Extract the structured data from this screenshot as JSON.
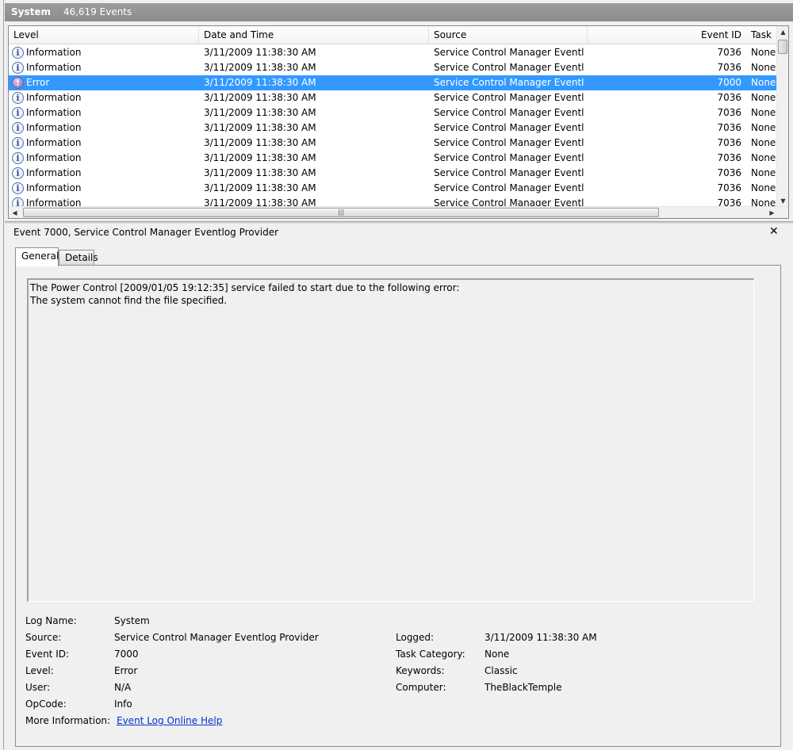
{
  "header": {
    "log_name": "System",
    "event_count": "46,619 Events"
  },
  "columns": {
    "level": "Level",
    "date": "Date and Time",
    "source": "Source",
    "event_id": "Event ID",
    "task": "Task"
  },
  "rows": [
    {
      "icon": "information-icon",
      "level": "Information",
      "date": "3/11/2009 11:38:30 AM",
      "source": "Service Control Manager Eventlog...",
      "event_id": "7036",
      "task": "None",
      "selected": false
    },
    {
      "icon": "information-icon",
      "level": "Information",
      "date": "3/11/2009 11:38:30 AM",
      "source": "Service Control Manager Eventlog...",
      "event_id": "7036",
      "task": "None",
      "selected": false
    },
    {
      "icon": "error-icon",
      "level": "Error",
      "date": "3/11/2009 11:38:30 AM",
      "source": "Service Control Manager Eventlog...",
      "event_id": "7000",
      "task": "None",
      "selected": true
    },
    {
      "icon": "information-icon",
      "level": "Information",
      "date": "3/11/2009 11:38:30 AM",
      "source": "Service Control Manager Eventlog...",
      "event_id": "7036",
      "task": "None",
      "selected": false
    },
    {
      "icon": "information-icon",
      "level": "Information",
      "date": "3/11/2009 11:38:30 AM",
      "source": "Service Control Manager Eventlog...",
      "event_id": "7036",
      "task": "None",
      "selected": false
    },
    {
      "icon": "information-icon",
      "level": "Information",
      "date": "3/11/2009 11:38:30 AM",
      "source": "Service Control Manager Eventlog...",
      "event_id": "7036",
      "task": "None",
      "selected": false
    },
    {
      "icon": "information-icon",
      "level": "Information",
      "date": "3/11/2009 11:38:30 AM",
      "source": "Service Control Manager Eventlog...",
      "event_id": "7036",
      "task": "None",
      "selected": false
    },
    {
      "icon": "information-icon",
      "level": "Information",
      "date": "3/11/2009 11:38:30 AM",
      "source": "Service Control Manager Eventlog...",
      "event_id": "7036",
      "task": "None",
      "selected": false
    },
    {
      "icon": "information-icon",
      "level": "Information",
      "date": "3/11/2009 11:38:30 AM",
      "source": "Service Control Manager Eventlog...",
      "event_id": "7036",
      "task": "None",
      "selected": false
    },
    {
      "icon": "information-icon",
      "level": "Information",
      "date": "3/11/2009 11:38:30 AM",
      "source": "Service Control Manager Eventlog...",
      "event_id": "7036",
      "task": "None",
      "selected": false
    },
    {
      "icon": "information-icon",
      "level": "Information",
      "date": "3/11/2009 11:38:30 AM",
      "source": "Service Control Manager Eventlog...",
      "event_id": "7036",
      "task": "None",
      "selected": false
    }
  ],
  "detail": {
    "title": "Event 7000, Service Control Manager Eventlog Provider",
    "close_icon": "close-icon",
    "tabs": {
      "general": "General",
      "details": "Details"
    },
    "message": [
      "The Power Control [2009/01/05 19:12:35] service failed to start due to the following error:",
      "The system cannot find the file specified."
    ],
    "props": {
      "log_name_label": "Log Name:",
      "log_name": "System",
      "source_label": "Source:",
      "source": "Service Control Manager Eventlog Provider",
      "logged_label": "Logged:",
      "logged": "3/11/2009 11:38:30 AM",
      "event_id_label": "Event ID:",
      "event_id": "7000",
      "task_category_label": "Task Category:",
      "task_category": "None",
      "level_label": "Level:",
      "level": "Error",
      "keywords_label": "Keywords:",
      "keywords": "Classic",
      "user_label": "User:",
      "user": "N/A",
      "computer_label": "Computer:",
      "computer": "TheBlackTemple",
      "opcode_label": "OpCode:",
      "opcode": "Info",
      "more_info_label": "More Information:",
      "more_info_link": "Event Log Online Help"
    }
  },
  "colors": {
    "selection": "#3399ff",
    "link": "#0033cc",
    "title_bar": "#8c8c8c"
  }
}
